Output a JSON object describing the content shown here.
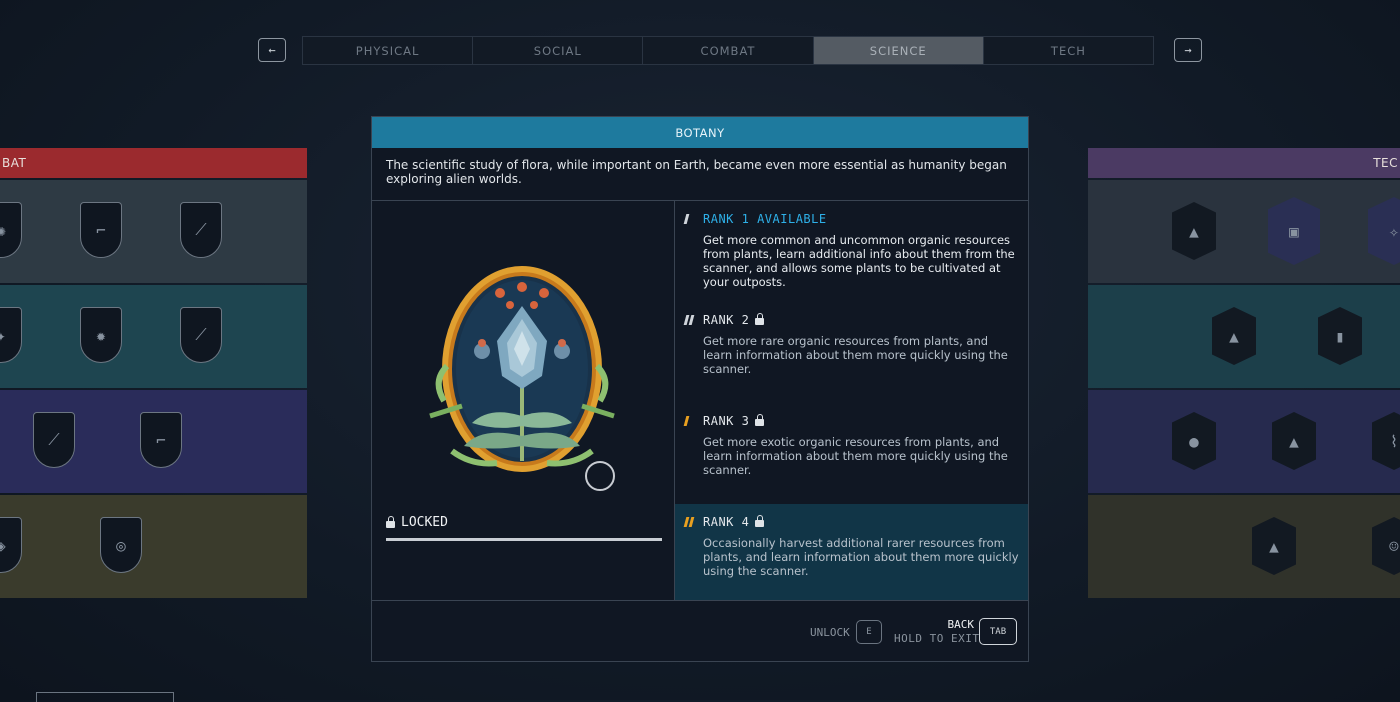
{
  "nav": {
    "prev_icon": "←",
    "next_icon": "→",
    "tabs": [
      {
        "label": "PHYSICAL",
        "active": false
      },
      {
        "label": "SOCIAL",
        "active": false
      },
      {
        "label": "COMBAT",
        "active": false
      },
      {
        "label": "SCIENCE",
        "active": true
      },
      {
        "label": "TECH",
        "active": false
      }
    ]
  },
  "left_panel": {
    "title": "BAT"
  },
  "right_panel": {
    "title": "TEC"
  },
  "skill": {
    "name": "BOTANY",
    "description": "The scientific study of flora, while important on Earth, became even more essential as humanity began exploring alien worlds.",
    "status": "LOCKED",
    "ranks": [
      {
        "title": "RANK 1 AVAILABLE",
        "text": "Get more common and uncommon organic resources from plants, learn additional info about them from the scanner, and allows some plants to be cultivated at your outposts."
      },
      {
        "title": "RANK 2",
        "text": "Get more rare organic resources from plants, and learn information about them more quickly using the scanner."
      },
      {
        "title": "RANK 3",
        "text": "Get more exotic organic resources from plants, and learn information about them more quickly using the scanner."
      },
      {
        "title": "RANK 4",
        "text": "Occasionally harvest additional rarer resources from plants, and learn information about them more quickly using the scanner."
      }
    ]
  },
  "footer": {
    "unlock_label": "UNLOCK",
    "unlock_key": "E",
    "back_label": "BACK",
    "exit_label": "HOLD TO EXIT",
    "back_key": "TAB"
  },
  "colors": {
    "header_blue": "#1e7a9e",
    "rank_available": "#2eb0e8",
    "rank_gold": "#e8a020",
    "combat_red": "#9b2a2e",
    "tech_purple": "#4b3a63"
  }
}
